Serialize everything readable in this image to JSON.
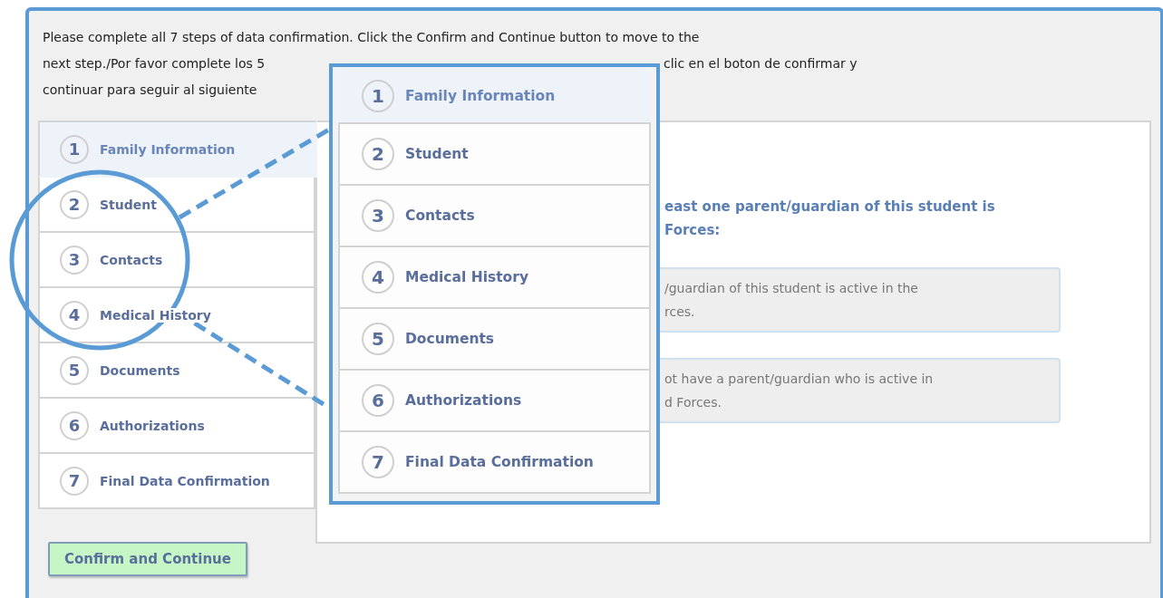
{
  "instructions": {
    "line_1": "Please complete all 7 steps of data confirmation. Click the Confirm and Continue button to move to the",
    "line_2_start": "next step./Por favor complete los 5",
    "line_2_end": "clic en el boton de confirmar y",
    "line_3_start": "continuar para seguir al siguiente"
  },
  "steps": [
    {
      "number": "1",
      "label": "Family Information",
      "selected": true
    },
    {
      "number": "2",
      "label": "Student",
      "selected": false
    },
    {
      "number": "3",
      "label": "Contacts",
      "selected": false
    },
    {
      "number": "4",
      "label": "Medical History",
      "selected": false
    },
    {
      "number": "5",
      "label": "Documents",
      "selected": false
    },
    {
      "number": "6",
      "label": "Authorizations",
      "selected": false
    },
    {
      "number": "7",
      "label": "Final Data Confirmation",
      "selected": false
    }
  ],
  "content": {
    "heading_lines": [
      "east one parent/guardian of this student is",
      "Forces:"
    ],
    "options": [
      {
        "lines": [
          "/guardian of this student is active in the",
          "rces."
        ]
      },
      {
        "lines": [
          "ot have a parent/guardian who is active in",
          "d Forces."
        ]
      }
    ]
  },
  "confirm_button": "Confirm and Continue",
  "callout": {
    "steps": [
      {
        "number": "1",
        "label": "Family Information",
        "selected": true
      },
      {
        "number": "2",
        "label": "Student",
        "selected": false
      },
      {
        "number": "3",
        "label": "Contacts",
        "selected": false
      },
      {
        "number": "4",
        "label": "Medical History",
        "selected": false
      },
      {
        "number": "5",
        "label": "Documents",
        "selected": false
      },
      {
        "number": "6",
        "label": "Authorizations",
        "selected": false
      },
      {
        "number": "7",
        "label": "Final Data Confirmation",
        "selected": false
      }
    ]
  }
}
